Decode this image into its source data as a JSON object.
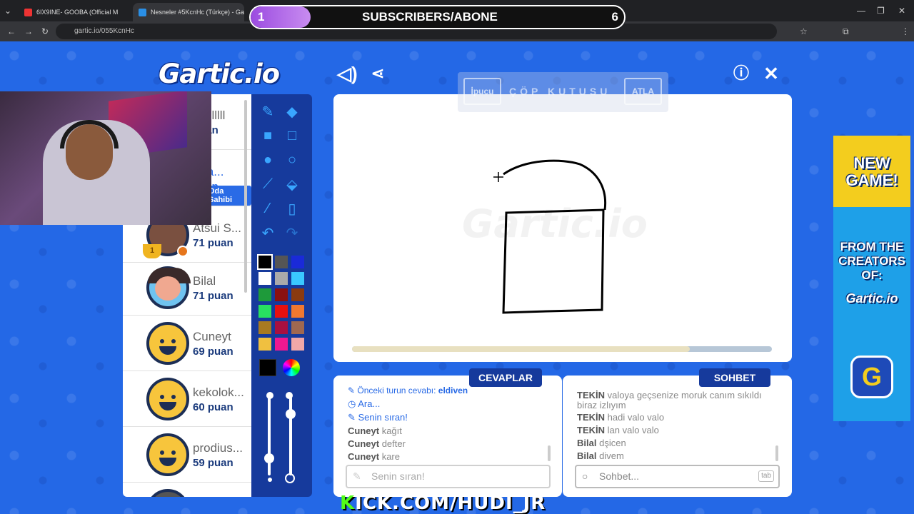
{
  "browser": {
    "tabs": [
      {
        "title": "6IX9INE- GOOBA (Official M"
      },
      {
        "title": "Nesneler #5KcnHc (Türkçe) - Ga"
      }
    ],
    "url": "gartic.io/055KcnHc"
  },
  "stream_overlay": {
    "goal_current": "1",
    "goal_label": "SUBSCRIBERS/ABONE",
    "goal_target": "6",
    "goal_progress": 0.16,
    "footer_prefix": "K",
    "footer_text": "ICK.COM/HUDI_JR"
  },
  "header": {
    "logo": "Gartic.io"
  },
  "players": [
    {
      "name": "nelllllll",
      "score": "puan"
    },
    {
      "name": "dıra...",
      "score": "puan",
      "badge": "Oda Sahibi"
    },
    {
      "name": "Atsui S...",
      "score": "71 puan"
    },
    {
      "name": "Bilal",
      "score": "71 puan"
    },
    {
      "name": "Cuneyt",
      "score": "69 puan"
    },
    {
      "name": "kekolok...",
      "score": "60 puan"
    },
    {
      "name": "prodius...",
      "score": "59 puan"
    }
  ],
  "trophy_rank": "1",
  "hint": {
    "ipucu_label": "İpucu",
    "hint_text": "ÇÖP KUTUSU",
    "skip_label": "ATLA"
  },
  "canvas": {
    "watermark": "Gartic.io",
    "time_remaining": 0.805
  },
  "answers": {
    "title": "CEVAPLAR",
    "lines": [
      {
        "pre": "Önceki turun cevabı: ",
        "val": "eldiven",
        "type": "info"
      },
      {
        "text": "Ara...",
        "type": "info"
      },
      {
        "text": "Senin sıran!",
        "type": "info"
      },
      {
        "user": "Cuneyt",
        "msg": "kağıt"
      },
      {
        "user": "Cuneyt",
        "msg": "defter"
      },
      {
        "user": "Cuneyt",
        "msg": "kare"
      }
    ],
    "placeholder": "Senin sıran!"
  },
  "chat": {
    "title": "SOHBET",
    "lines": [
      {
        "user": "TEKİN",
        "msg": "valoya geçsenize moruk canım sıkıldı"
      },
      {
        "user": "",
        "msg": "biraz izlıyım"
      },
      {
        "user": "TEKİN",
        "msg": "hadi valo valo"
      },
      {
        "user": "TEKİN",
        "msg": "lan valo valo"
      },
      {
        "user": "Bilal",
        "msg": "dşicen"
      },
      {
        "user": "Bilal",
        "msg": "divem"
      }
    ],
    "placeholder": "Sohbet...",
    "tab_key": "tab"
  },
  "ad": {
    "line1": "NEW",
    "line2": "GAME!",
    "line3": "FROM THE",
    "line4": "CREATORS",
    "line5": "OF:",
    "logo": "Gartic.io",
    "icon": "G"
  },
  "palette": [
    "#000000",
    "#555555",
    "#1a2ad8",
    "#ffffff",
    "#aaaaaa",
    "#3ac8ff",
    "#1e9a3a",
    "#8a1010",
    "#8a3a10",
    "#28e060",
    "#e81010",
    "#f07830",
    "#a87a20",
    "#a81040",
    "#a06850",
    "#f0c040",
    "#f01890",
    "#f0a8a8"
  ],
  "colors": {
    "accent": "#163a9c",
    "page_bg": "#2468e6",
    "score": "#1a3a7c"
  }
}
